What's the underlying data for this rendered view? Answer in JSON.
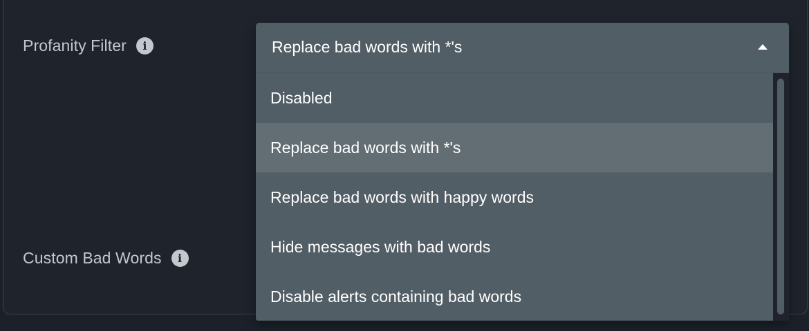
{
  "settings": {
    "profanity_filter": {
      "label": "Profanity Filter",
      "info_icon": "info-icon",
      "dropdown": {
        "selected": "Replace bad words with *'s",
        "expanded": true,
        "caret_icon": "caret-up-icon",
        "options": [
          "Disabled",
          "Replace bad words with *'s",
          "Replace bad words with happy words",
          "Hide messages with bad words",
          "Disable alerts containing bad words"
        ],
        "highlighted_index": 1
      }
    },
    "custom_bad_words": {
      "label": "Custom Bad Words",
      "info_icon": "info-icon"
    }
  },
  "colors": {
    "background": "#1c2029",
    "card": "#1f232b",
    "dropdown": "#525e65",
    "dropdown_highlight": "#626e74",
    "label_text": "#c4c8ce",
    "option_text": "#ffffff"
  }
}
